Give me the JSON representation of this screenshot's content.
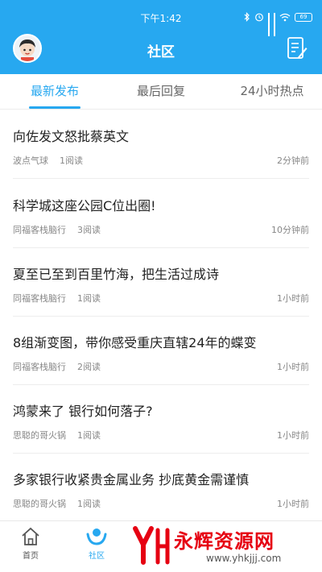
{
  "status_bar": {
    "time": "下午1:42",
    "battery": "69"
  },
  "header": {
    "title": "社区"
  },
  "tabs": [
    {
      "label": "最新发布",
      "active": true
    },
    {
      "label": "最后回复",
      "active": false
    },
    {
      "label": "24小时热点",
      "active": false
    }
  ],
  "posts": [
    {
      "title": "向佐发文怒批蔡英文",
      "author": "波点气球",
      "reads": "1阅读",
      "time": "2分钟前"
    },
    {
      "title": "科学城这座公园C位出圈!",
      "author": "同福客栈脑行",
      "reads": "3阅读",
      "time": "10分钟前"
    },
    {
      "title": "夏至已至到百里竹海，把生活过成诗",
      "author": "同福客栈脑行",
      "reads": "1阅读",
      "time": "1小时前"
    },
    {
      "title": "8组渐变图，带你感受重庆直辖24年的蝶变",
      "author": "同福客栈脑行",
      "reads": "2阅读",
      "time": "1小时前"
    },
    {
      "title": "鸿蒙来了 银行如何落子?",
      "author": "思聪的哥火锅",
      "reads": "1阅读",
      "time": "1小时前"
    },
    {
      "title": "多家银行收紧贵金属业务 抄底黄金需谨慎",
      "author": "思聪的哥火锅",
      "reads": "1阅读",
      "time": "1小时前"
    }
  ],
  "bottom_nav": [
    {
      "label": "首页",
      "icon": "home-icon",
      "active": false
    },
    {
      "label": "社区",
      "icon": "community-icon",
      "active": true
    }
  ],
  "watermark": {
    "name": "永辉资源网",
    "url": "www.yhkjjj.com"
  },
  "colors": {
    "accent": "#27a8f0",
    "watermark": "#e60012"
  }
}
